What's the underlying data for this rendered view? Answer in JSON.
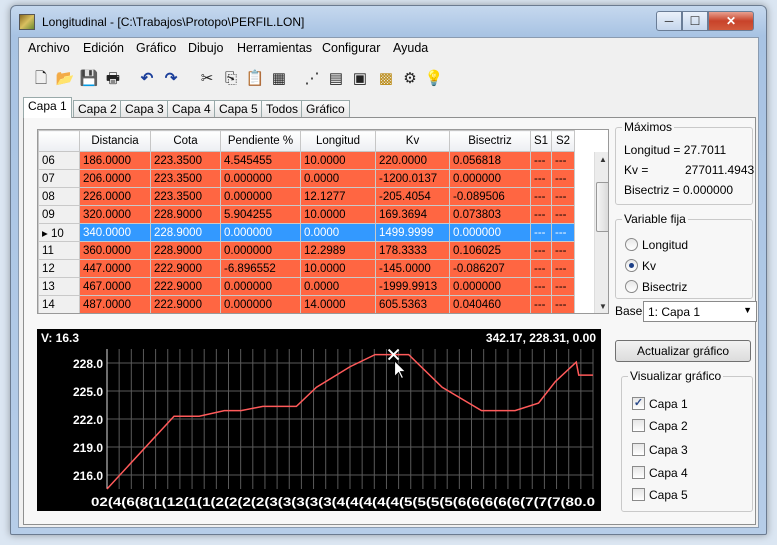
{
  "window": {
    "title": "Longitudinal - [C:\\Trabajos\\Protopo\\PERFIL.LON]",
    "min": "─",
    "max": "☐",
    "close": "✕"
  },
  "menu": [
    "Archivo",
    "Edición",
    "Gráfico",
    "Dibujo",
    "Herramientas",
    "Configurar",
    "Ayuda"
  ],
  "toolbar": {
    "icons": [
      "new-icon",
      "open-icon",
      "save-icon",
      "print-icon",
      "undo-icon",
      "redo-icon",
      "cut-icon",
      "copy-icon",
      "paste-icon",
      "paste-fill-icon",
      "profile-icon",
      "table-icon",
      "edit-table-icon",
      "grid-pattern-icon",
      "settings-icon",
      "cota-icon"
    ],
    "glyphs": [
      "🗋",
      "📂",
      "💾",
      "🖶",
      "↶",
      "↷",
      "✂",
      "⎘",
      "📋",
      "▦",
      "⋰",
      "▤",
      "▣",
      "▩",
      "⚙",
      "💡"
    ]
  },
  "tabs": [
    "Capa 1",
    "Capa 2",
    "Capa 3",
    "Capa 4",
    "Capa 5",
    "Todos",
    "Gráfico"
  ],
  "table": {
    "columns": [
      "",
      "Distancia",
      "Cota",
      "Pendiente %",
      "Longitud",
      "Kv",
      "Bisectriz",
      "S1",
      "S2"
    ],
    "rows": [
      {
        "id": "06",
        "cells": [
          "186.0000",
          "223.3500",
          "4.545455",
          "10.0000",
          "220.0000",
          "0.056818",
          "---",
          "---"
        ]
      },
      {
        "id": "07",
        "cells": [
          "206.0000",
          "223.3500",
          "0.000000",
          "0.0000",
          "-1200.0137",
          "0.000000",
          "---",
          "---"
        ]
      },
      {
        "id": "08",
        "cells": [
          "226.0000",
          "223.3500",
          "0.000000",
          "12.1277",
          "-205.4054",
          "-0.089506",
          "---",
          "---"
        ]
      },
      {
        "id": "09",
        "cells": [
          "320.0000",
          "228.9000",
          "5.904255",
          "10.0000",
          "169.3694",
          "0.073803",
          "---",
          "---"
        ]
      },
      {
        "id": "10",
        "cells": [
          "340.0000",
          "228.9000",
          "0.000000",
          "0.0000",
          "1499.9999",
          "0.000000",
          "---",
          "---"
        ]
      },
      {
        "id": "11",
        "cells": [
          "360.0000",
          "228.9000",
          "0.000000",
          "12.2989",
          "178.3333",
          "0.106025",
          "---",
          "---"
        ]
      },
      {
        "id": "12",
        "cells": [
          "447.0000",
          "222.9000",
          "-6.896552",
          "10.0000",
          "-145.0000",
          "-0.086207",
          "---",
          "---"
        ]
      },
      {
        "id": "13",
        "cells": [
          "467.0000",
          "222.9000",
          "0.000000",
          "0.0000",
          "-1999.9913",
          "0.000000",
          "---",
          "---"
        ]
      },
      {
        "id": "14",
        "cells": [
          "487.0000",
          "222.9000",
          "0.000000",
          "14.0000",
          "605.5363",
          "0.040460",
          "---",
          "---"
        ]
      }
    ],
    "selected_row": "10",
    "row_color": "#ff6642",
    "selected_color": "#3399ff"
  },
  "maximos": {
    "legend": "Máximos",
    "longitud": "Longitud = 27.7011",
    "kv_label": "Kv =",
    "kv_value": "277011.4943",
    "bisectriz": "Bisectriz = 0.000000"
  },
  "variable_fija": {
    "legend": "Variable fija",
    "options": [
      "Longitud",
      "Kv",
      "Bisectriz"
    ],
    "selected": "Kv"
  },
  "base": {
    "label": "Base",
    "value": "1: Capa 1"
  },
  "actualizar_button": "Actualizar gráfico",
  "visualizar": {
    "legend": "Visualizar gráfico",
    "items": [
      {
        "label": "Capa 1",
        "checked": true
      },
      {
        "label": "Capa 2",
        "checked": false
      },
      {
        "label": "Capa 3",
        "checked": false
      },
      {
        "label": "Capa 4",
        "checked": false
      },
      {
        "label": "Capa 5",
        "checked": false
      }
    ]
  },
  "chart_data": {
    "type": "line",
    "readout_left": "V: 16.3",
    "readout_right": "342.17,  228.31, 0.00",
    "yticks": [
      "228.0",
      "225.0",
      "222.0",
      "219.0",
      "216.0"
    ],
    "xtick_text": "02(4(6(8(1(12(1(1(2(2(2(2(3(3(3(3(3(4(4(4(4(4(5(5(5(5(6(6(6(6(6(7(7(7(80.0",
    "ylim": [
      214.5,
      229.5
    ],
    "xlim": [
      0,
      580
    ],
    "x": [
      0,
      80,
      95,
      110,
      140,
      160,
      186,
      206,
      226,
      250,
      290,
      320,
      340,
      360,
      400,
      447,
      467,
      487,
      515,
      535,
      560,
      563,
      580
    ],
    "y": [
      214.5,
      222.3,
      222.3,
      222.3,
      222.9,
      222.9,
      223.35,
      223.35,
      223.35,
      225.4,
      227.6,
      228.9,
      228.9,
      228.9,
      225.4,
      222.9,
      222.9,
      222.9,
      223.7,
      226.0,
      228.1,
      226.7,
      226.7
    ],
    "marker": {
      "x": 342,
      "y": 228.9
    },
    "line_color": "#ff5a5a",
    "grid_color": "#5a5a5a"
  }
}
